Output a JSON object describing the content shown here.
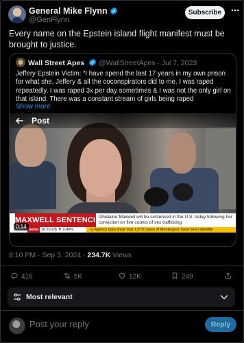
{
  "tweet": {
    "author_name": "General Mike Flynn",
    "author_handle": "@GenFlynn",
    "subscribe_label": "Subscribe",
    "text": "Every name on the Epstein island flight manifest must be brought to justice.",
    "timestamp": "8:10 PM · Sep 3, 2024 ·",
    "views_count": "234.7K",
    "views_label": "Views"
  },
  "quote": {
    "author_name": "Wall Street Apes",
    "author_handle": "@WallStreetApes",
    "date": "· Jul 7, 2023",
    "text": "Jeffery Epstein Victim: “I have spend the last 17 years in my own prison for what she, Jeffery & all the coconspirators did to me. I was raped repeatedly, I was raped 3x per day sometimes & I was not the only girl on that island. There was a constant stream of girls being raped",
    "show_more": "Show more",
    "video": {
      "overlay_label": "Post",
      "lower_third_title": "MAXWELL SENTENCING",
      "lower_third_text": "Ghislaine Maxwell will be sentenced in the U.S. today following her conviction on five counts of sex trafficking",
      "ticker_badge": "news",
      "ticker_time": "16:20",
      "ticker_market": "£/$ ▼ 0.48%",
      "ticker_text": "ty Agency data show that 1,076 cases of Monkeypox have been identifie",
      "timecode": "0:14"
    }
  },
  "actions": {
    "replies": "416",
    "reposts": "5K",
    "likes": "12K",
    "bookmarks": "249"
  },
  "sort": {
    "label": "Most relevant"
  },
  "reply": {
    "placeholder": "Post your reply",
    "button_label": "Reply"
  },
  "colors": {
    "background": "#000000",
    "accent": "#1d9bf0",
    "muted": "#71767b",
    "breaking_red": "#c4161c",
    "ticker_yellow": "#f6c200"
  }
}
